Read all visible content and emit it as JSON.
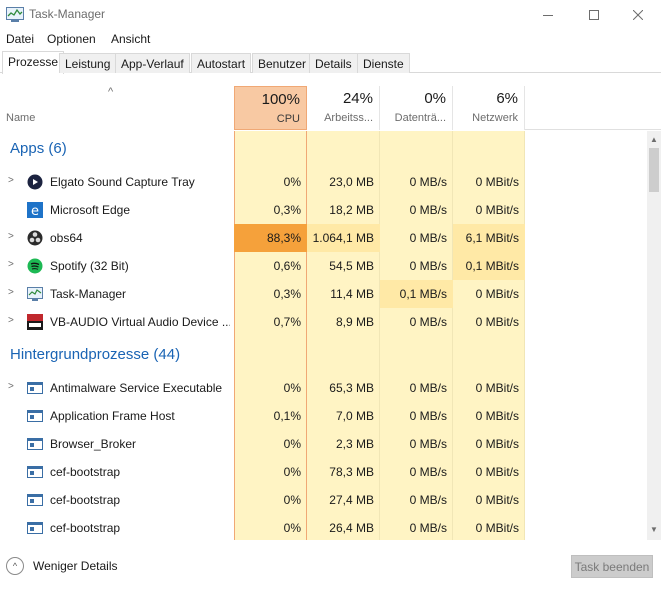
{
  "window": {
    "title": "Task-Manager",
    "app_icon": "task-manager-icon"
  },
  "menu": [
    "Datei",
    "Optionen",
    "Ansicht"
  ],
  "tabs": [
    "Prozesse",
    "Leistung",
    "App-Verlauf",
    "Autostart",
    "Benutzer",
    "Details",
    "Dienste"
  ],
  "active_tab": "Prozesse",
  "columns": {
    "name": "Name",
    "cpu": {
      "pct": "100%",
      "label": "CPU"
    },
    "mem": {
      "pct": "24%",
      "label": "Arbeitss..."
    },
    "disk": {
      "pct": "0%",
      "label": "Datenträ..."
    },
    "net": {
      "pct": "6%",
      "label": "Netzwerk"
    }
  },
  "groups": [
    {
      "title": "Apps (6)",
      "rows": [
        {
          "name": "Elgato Sound Capture Tray",
          "icon": "elgato-icon",
          "expandable": true,
          "cpu": "0%",
          "mem": "23,0 MB",
          "disk": "0 MB/s",
          "net": "0 MBit/s"
        },
        {
          "name": "Microsoft Edge",
          "icon": "edge-icon",
          "expandable": false,
          "cpu": "0,3%",
          "mem": "18,2 MB",
          "disk": "0 MB/s",
          "net": "0 MBit/s"
        },
        {
          "name": "obs64",
          "icon": "obs-icon",
          "expandable": true,
          "cpu": "88,3%",
          "mem": "1.064,1 MB",
          "disk": "0 MB/s",
          "net": "6,1 MBit/s"
        },
        {
          "name": "Spotify (32 Bit)",
          "icon": "spotify-icon",
          "expandable": true,
          "cpu": "0,6%",
          "mem": "54,5 MB",
          "disk": "0 MB/s",
          "net": "0,1 MBit/s"
        },
        {
          "name": "Task-Manager",
          "icon": "task-manager-icon",
          "expandable": true,
          "cpu": "0,3%",
          "mem": "11,4 MB",
          "disk": "0,1 MB/s",
          "net": "0 MBit/s"
        },
        {
          "name": "VB-AUDIO Virtual Audio Device ...",
          "icon": "vb-audio-icon",
          "expandable": true,
          "cpu": "0,7%",
          "mem": "8,9 MB",
          "disk": "0 MB/s",
          "net": "0 MBit/s"
        }
      ]
    },
    {
      "title": "Hintergrundprozesse (44)",
      "rows": [
        {
          "name": "Antimalware Service Executable",
          "icon": "process-icon",
          "expandable": true,
          "cpu": "0%",
          "mem": "65,3 MB",
          "disk": "0 MB/s",
          "net": "0 MBit/s"
        },
        {
          "name": "Application Frame Host",
          "icon": "process-icon",
          "expandable": false,
          "cpu": "0,1%",
          "mem": "7,0 MB",
          "disk": "0 MB/s",
          "net": "0 MBit/s"
        },
        {
          "name": "Browser_Broker",
          "icon": "process-icon",
          "expandable": false,
          "cpu": "0%",
          "mem": "2,3 MB",
          "disk": "0 MB/s",
          "net": "0 MBit/s"
        },
        {
          "name": "cef-bootstrap",
          "icon": "process-icon",
          "expandable": false,
          "cpu": "0%",
          "mem": "78,3 MB",
          "disk": "0 MB/s",
          "net": "0 MBit/s"
        },
        {
          "name": "cef-bootstrap",
          "icon": "process-icon",
          "expandable": false,
          "cpu": "0%",
          "mem": "27,4 MB",
          "disk": "0 MB/s",
          "net": "0 MBit/s"
        },
        {
          "name": "cef-bootstrap",
          "icon": "process-icon",
          "expandable": false,
          "cpu": "0%",
          "mem": "26,4 MB",
          "disk": "0 MB/s",
          "net": "0 MBit/s"
        }
      ]
    }
  ],
  "footer": {
    "less_details": "Weniger Details",
    "end_task": "Task beenden"
  },
  "colors": {
    "group_title": "#1a64b4",
    "cpu_header": "#f8c9a3",
    "cell_bg": "#fff4c4",
    "cell_hot": "#f5a13b",
    "cell_warm": "#ffe9a6"
  }
}
